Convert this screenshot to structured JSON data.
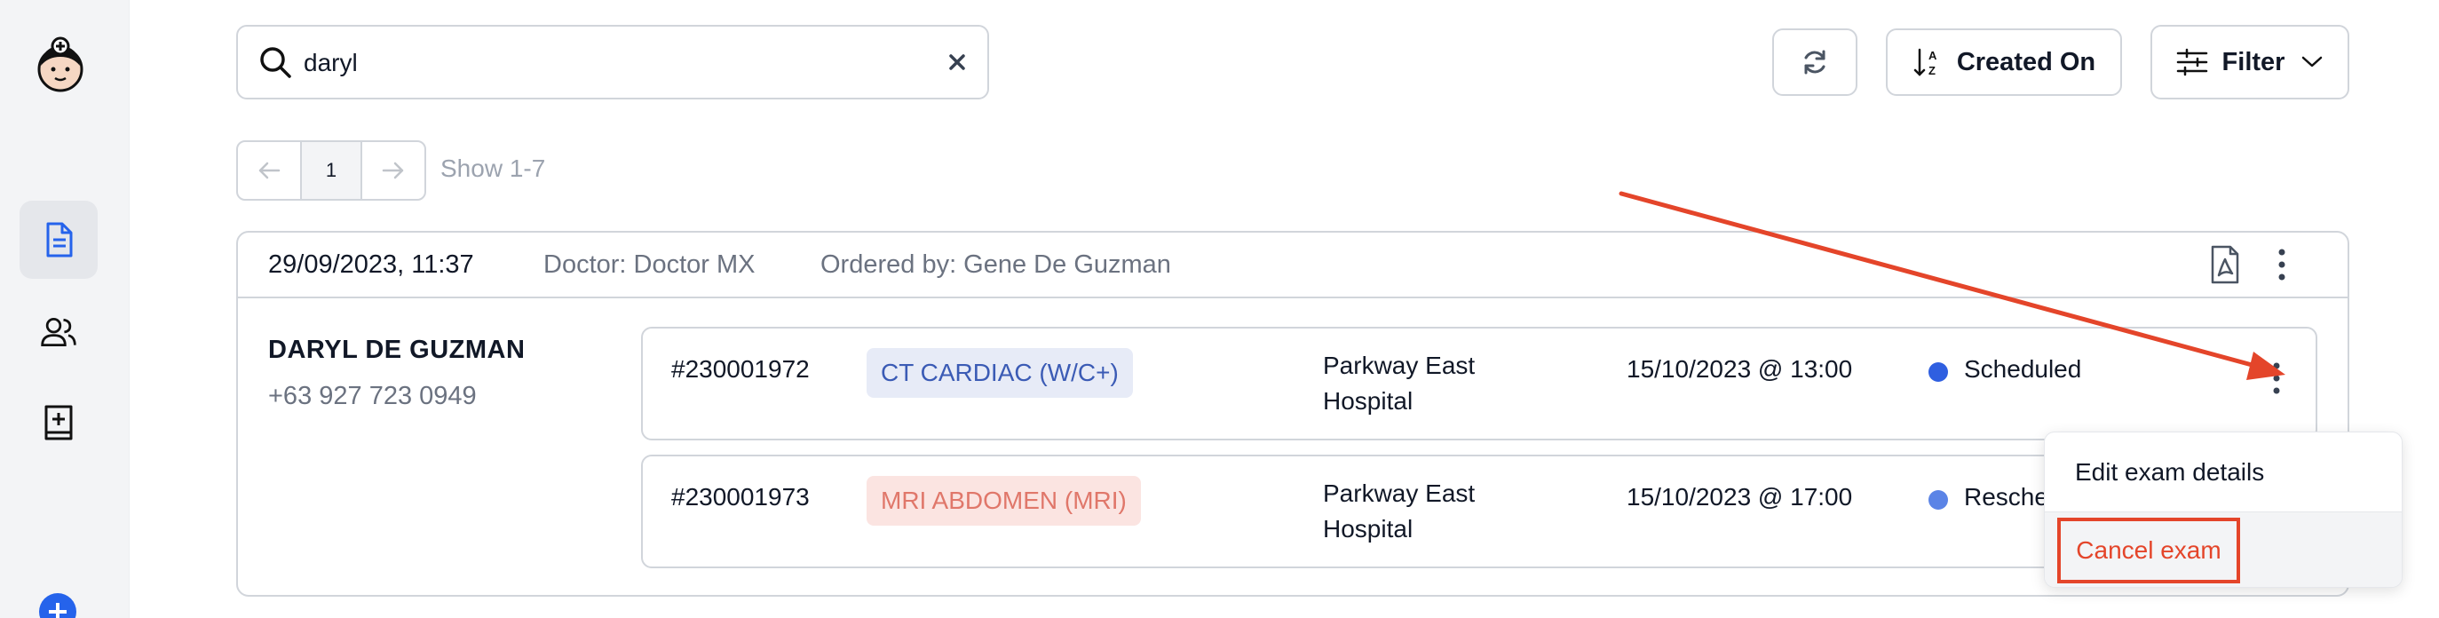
{
  "search": {
    "value": "daryl",
    "placeholder": ""
  },
  "toolbar": {
    "sort_label": "Created On",
    "filter_label": "Filter"
  },
  "pagination": {
    "current_page": "1",
    "range_text": "Show 1-7"
  },
  "order": {
    "datetime": "29/09/2023, 11:37",
    "doctor": "Doctor: Doctor MX",
    "ordered_by": "Ordered by: Gene De Guzman",
    "patient_name": "DARYL DE GUZMAN",
    "patient_phone": "+63 927 723 0949",
    "exams": [
      {
        "id": "#230001972",
        "name": "CT CARDIAC (W/C+)",
        "location_line1": "Parkway East",
        "location_line2": "Hospital",
        "datetime": "15/10/2023 @ 13:00",
        "status": "Scheduled"
      },
      {
        "id": "#230001973",
        "name": "MRI ABDOMEN (MRI)",
        "location_line1": "Parkway East",
        "location_line2": "Hospital",
        "datetime": "15/10/2023 @ 17:00",
        "status": "Resche"
      }
    ]
  },
  "context_menu": {
    "edit_label": "Edit exam details",
    "cancel_label": "Cancel exam"
  },
  "colors": {
    "accent": "#2563eb",
    "annotation": "#e4452a",
    "tag_blue_bg": "#e7ebf7",
    "tag_red_bg": "#fbe4e1"
  },
  "icons": [
    "app-logo-icon",
    "document-icon",
    "users-icon",
    "add-record-icon",
    "plus-icon",
    "search-icon",
    "clear-icon",
    "refresh-icon",
    "sort-az-icon",
    "filter-sliders-icon",
    "chevron-down-icon",
    "arrow-left-icon",
    "arrow-right-icon",
    "pdf-icon",
    "kebab-icon"
  ]
}
